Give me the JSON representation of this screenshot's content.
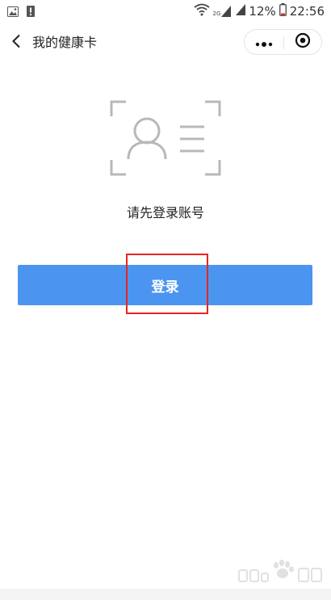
{
  "status_bar": {
    "signal_label": "2G",
    "battery_percent": "12%",
    "time": "22:56"
  },
  "nav": {
    "title": "我的健康卡"
  },
  "content": {
    "prompt": "请先登录账号",
    "login_label": "登录"
  },
  "colors": {
    "primary_button": "#4b95f0",
    "highlight": "#e8251f",
    "icon_gray": "#b8b8b8"
  }
}
